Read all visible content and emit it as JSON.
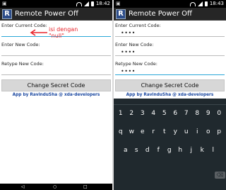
{
  "status_left": {
    "time": "18:42"
  },
  "status_right": {
    "time": "18:43"
  },
  "app": {
    "title": "Remote Power Off",
    "icon_letter": "R"
  },
  "form": {
    "current_label": "Enter Current Code:",
    "new_label": "Enter New Code:",
    "retype_label": "Retype New Code:",
    "button_label": "Change Secret Code",
    "credit": "App by RavinduSha @ xda-developers"
  },
  "left_values": {
    "current": "",
    "new": "",
    "retype": ""
  },
  "right_values": {
    "current": "••••",
    "new": "••••",
    "retype": "••••"
  },
  "annotation": {
    "line1": "isi dengan",
    "line2": "\"null\""
  },
  "keyboard": {
    "row1": [
      "1",
      "2",
      "3",
      "4",
      "5",
      "6",
      "7",
      "8",
      "9",
      "0"
    ],
    "row2": [
      "q",
      "w",
      "e",
      "r",
      "t",
      "y",
      "u",
      "i",
      "o",
      "p"
    ],
    "row3": [
      "a",
      "s",
      "d",
      "f",
      "g",
      "h",
      "j",
      "k",
      "l"
    ],
    "backspace_icon": "backspace-icon"
  },
  "colors": {
    "focus_underline": "#2aa8d8",
    "credit": "#1a47a0",
    "annotation": "#e8242b",
    "keyboard_bg": "#20292e"
  }
}
